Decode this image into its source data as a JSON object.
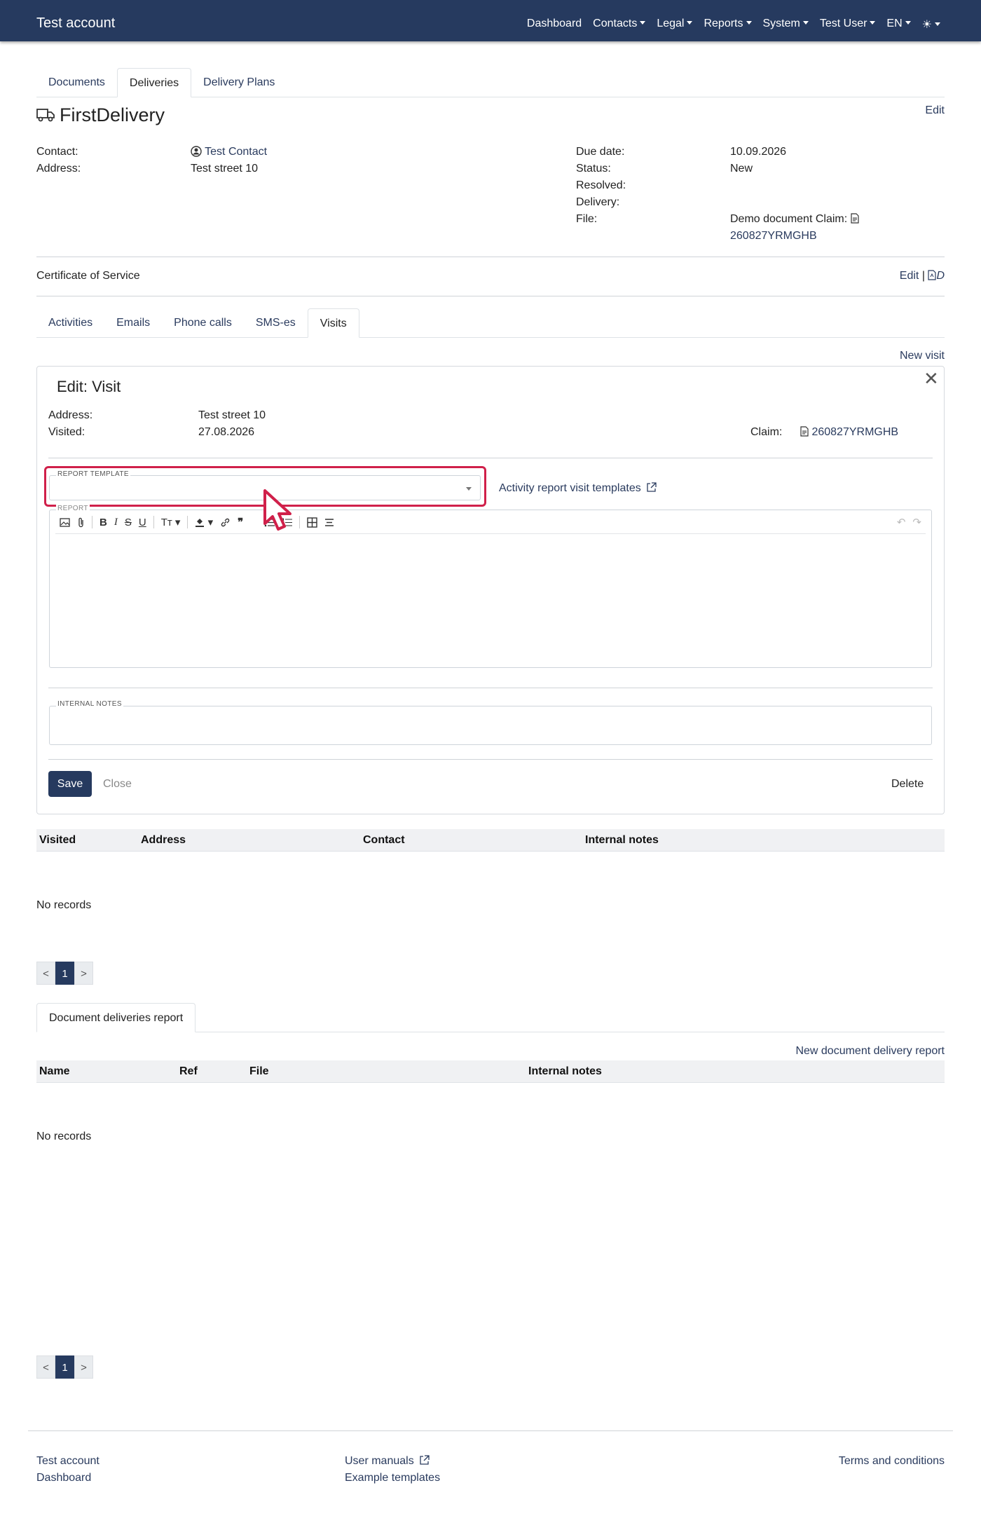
{
  "navbar": {
    "brand": "Test account",
    "items": [
      "Dashboard",
      "Contacts",
      "Legal",
      "Reports",
      "System",
      "Test User",
      "EN"
    ]
  },
  "top_tabs": [
    "Documents",
    "Deliveries",
    "Delivery Plans"
  ],
  "delivery": {
    "title": "FirstDelivery",
    "edit_label": "Edit",
    "contact_label": "Contact:",
    "contact_value": "Test Contact",
    "address_label": "Address:",
    "address_value": "Test street 10",
    "due_label": "Due date:",
    "due_value": "10.09.2026",
    "status_label": "Status:",
    "status_value": "New",
    "resolved_label": "Resolved:",
    "delivery_label": "Delivery:",
    "file_label": "File:",
    "file_value_line1": "Demo document Claim:",
    "file_value_line2": "260827YRMGHB"
  },
  "certificate": {
    "label": "Certificate of Service",
    "edit_label": "Edit",
    "separator": "|",
    "doc_label": "D"
  },
  "sub_tabs": [
    "Activities",
    "Emails",
    "Phone calls",
    "SMS-es",
    "Visits"
  ],
  "new_visit_label": "New visit",
  "visit_form": {
    "heading": "Edit: Visit",
    "address_label": "Address:",
    "address_value": "Test street 10",
    "visited_label": "Visited:",
    "visited_value": "27.08.2026",
    "claim_label": "Claim:",
    "claim_value": "260827YRMGHB",
    "report_template_label": "REPORT TEMPLATE",
    "report_template_value": "",
    "templates_link": "Activity report visit templates",
    "report_label": "REPORT",
    "internal_notes_label": "INTERNAL NOTES",
    "save_label": "Save",
    "close_label": "Close",
    "delete_label": "Delete"
  },
  "visits_table": {
    "columns": [
      "Visited",
      "Address",
      "Contact",
      "Internal notes"
    ],
    "empty_text": "No records"
  },
  "pagination": {
    "prev": "<",
    "page": "1",
    "next": ">"
  },
  "reports_tab": "Document deliveries report",
  "new_report_label": "New document delivery report",
  "reports_table": {
    "columns": [
      "Name",
      "Ref",
      "File",
      "Internal notes"
    ],
    "empty_text": "No records"
  },
  "footer": {
    "col1": [
      "Test account",
      "Dashboard"
    ],
    "col2": [
      "User manuals",
      "Example templates"
    ],
    "terms": "Terms and conditions"
  },
  "colors": {
    "navbar": "#263a5f",
    "link": "#2a3b5e",
    "highlight": "#d0204a"
  }
}
